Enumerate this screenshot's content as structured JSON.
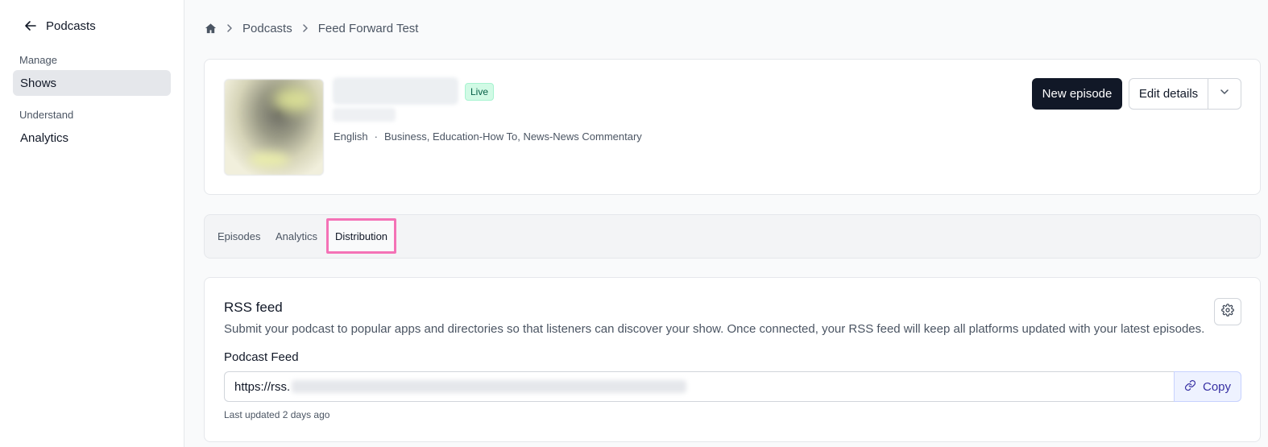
{
  "sidebar": {
    "back_label": "Podcasts",
    "sections": [
      {
        "label": "Manage",
        "items": [
          {
            "label": "Shows",
            "active": true
          }
        ]
      },
      {
        "label": "Understand",
        "items": [
          {
            "label": "Analytics",
            "active": false
          }
        ]
      }
    ]
  },
  "breadcrumb": {
    "items": [
      "Podcasts",
      "Feed Forward Test"
    ]
  },
  "show": {
    "status_badge": "Live",
    "language": "English",
    "separator": "·",
    "categories": "Business, Education-How To, News-News Commentary",
    "new_episode_label": "New episode",
    "edit_details_label": "Edit details"
  },
  "tabs": [
    {
      "label": "Episodes",
      "active": false
    },
    {
      "label": "Analytics",
      "active": false
    },
    {
      "label": "Distribution",
      "active": true
    }
  ],
  "rss": {
    "title": "RSS feed",
    "description": "Submit your podcast to popular apps and directories so that listeners can discover your show. Once connected, your RSS feed will keep all platforms updated with your latest episodes.",
    "feed_label": "Podcast Feed",
    "feed_url_prefix": "https://rss.",
    "copy_label": "Copy",
    "last_updated": "Last updated 2 days ago"
  },
  "colors": {
    "primary_button": "#111827",
    "live_badge_bg": "#d1fae5",
    "active_tab_highlight": "#f472b6",
    "copy_accent": "#3730a3"
  },
  "icons": {
    "back": "arrow-left-icon",
    "home": "home-icon",
    "separator": "chevron-right-icon",
    "dropdown": "chevron-down-icon",
    "settings": "gear-icon",
    "copy": "link-icon"
  }
}
